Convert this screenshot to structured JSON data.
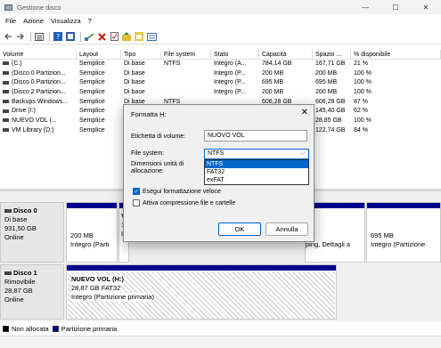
{
  "window": {
    "title": "Gestione disco",
    "controls": [
      "—",
      "☐",
      "✕"
    ]
  },
  "menu": [
    "File",
    "Azione",
    "Visualizza",
    "?"
  ],
  "toolbar": {
    "icons": [
      "back-arrow-icon",
      "forward-arrow-icon",
      "list-view-icon",
      "help-icon",
      "properties-icon",
      "connect-icon",
      "delete-icon",
      "check-icon",
      "folder-up-icon",
      "export-icon",
      "properties-sheet-icon"
    ]
  },
  "volume_table": {
    "headers": [
      "Volume",
      "Layout",
      "Tipo",
      "File system",
      "Stato",
      "Capacità",
      "Spazio ...",
      "% disponibile"
    ],
    "rows": [
      [
        "(C:)",
        "Semplice",
        "Di base",
        "NTFS",
        "Integro (A...",
        "784,14 GB",
        "167,71 GB",
        "21 %"
      ],
      [
        "(Disco 0 Partizion...",
        "Semplice",
        "Di base",
        "",
        "Integro (P...",
        "200 MB",
        "200 MB",
        "100 %"
      ],
      [
        "(Disco 0 Partizion...",
        "Semplice",
        "Di base",
        "",
        "Integro (P...",
        "695 MB",
        "695 MB",
        "100 %"
      ],
      [
        "(Disco 2 Partizion...",
        "Semplice",
        "Di base",
        "",
        "Integro (P...",
        "200 MB",
        "200 MB",
        "100 %"
      ],
      [
        "Backups Windows...",
        "Semplice",
        "Di base",
        "NTFS",
        "",
        "606,28 GB",
        "606,28 GB",
        "87 %"
      ],
      [
        "Drive (I:)",
        "Semplice",
        "Di base",
        "",
        "",
        "",
        "145,40 GB",
        "62 %"
      ],
      [
        "NUEVO VOL (...",
        "Semplice",
        "D",
        "",
        "",
        "",
        "28,85 GB",
        "100 %"
      ],
      [
        "VM Library (D:)",
        "Semplice",
        "D",
        "",
        "",
        "",
        "122,74 GB",
        "84 %"
      ]
    ]
  },
  "disks": [
    {
      "name": "Disco 0",
      "type": "Di base",
      "size": "931,50 GB",
      "status": "Online",
      "partitions": [
        {
          "size": "200 MB",
          "status": "Integro (Parti"
        },
        {
          "name": "VI",
          "size": "14",
          "status": "In"
        },
        {
          "status": "ping, Dettagli a"
        },
        {
          "size": "695 MB",
          "status": "Integro (Partizione"
        }
      ]
    },
    {
      "name": "Disco 1",
      "type": "Rimovibile",
      "size": "28,87 GB",
      "status": "Online",
      "partitions": [
        {
          "name": "NUEVO VOL  (H:)",
          "size": "28,87 GB FAT32",
          "status": "Integro (Partizione primaria)"
        }
      ]
    }
  ],
  "legend": [
    {
      "label": "Non allocata",
      "color": "#000000"
    },
    {
      "label": "Partizione primaria",
      "color": "#00008b"
    }
  ],
  "dialog": {
    "title": "Formatta H:",
    "volume_label_caption": "Etichetta di volume:",
    "volume_label_value": "NUOVO VOL",
    "file_system_caption": "File system:",
    "file_system_value": "NTFS",
    "file_system_options": [
      "NTFS",
      "FAT32",
      "exFAT"
    ],
    "alloc_caption_1": "Dimensioni unità di",
    "alloc_caption_2": "allocazione:",
    "quick_format_label": "Esegui formattazione veloce",
    "quick_format_checked": true,
    "compression_label": "Attiva compressione file e cartelle",
    "compression_checked": false,
    "ok_label": "OK",
    "cancel_label": "Annulla"
  }
}
